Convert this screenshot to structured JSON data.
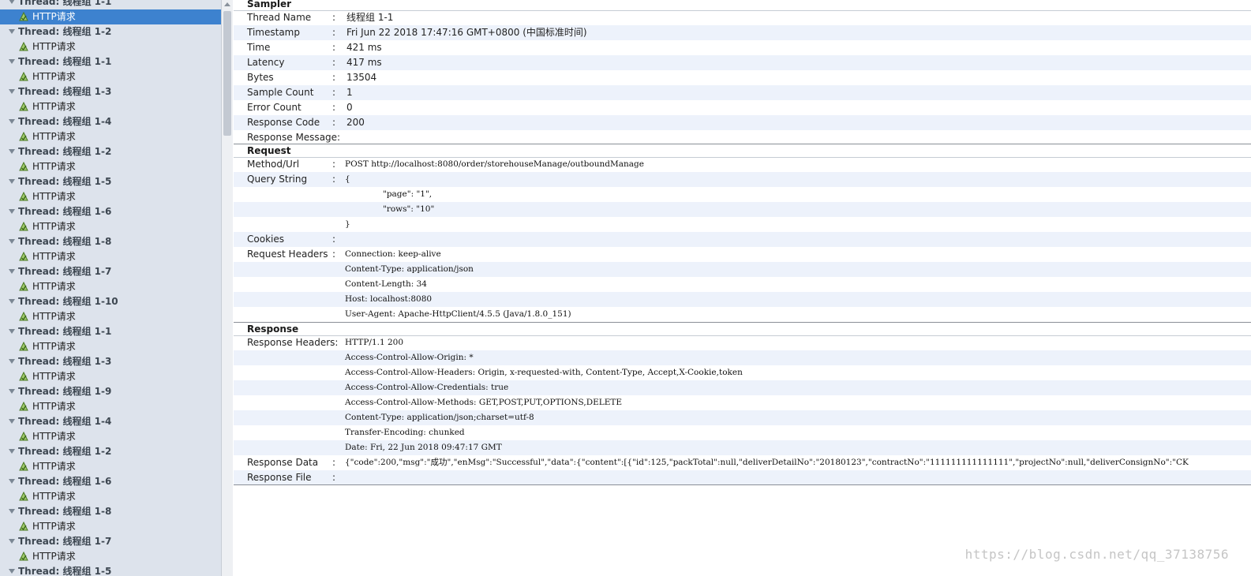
{
  "tree": [
    {
      "type": "thread",
      "label": "Thread: 线程组 1-1"
    },
    {
      "type": "sampler",
      "label": "HTTP请求",
      "selected": true
    },
    {
      "type": "thread",
      "label": "Thread: 线程组 1-2"
    },
    {
      "type": "sampler",
      "label": "HTTP请求"
    },
    {
      "type": "thread",
      "label": "Thread: 线程组 1-1"
    },
    {
      "type": "sampler",
      "label": "HTTP请求"
    },
    {
      "type": "thread",
      "label": "Thread: 线程组 1-3"
    },
    {
      "type": "sampler",
      "label": "HTTP请求"
    },
    {
      "type": "thread",
      "label": "Thread: 线程组 1-4"
    },
    {
      "type": "sampler",
      "label": "HTTP请求"
    },
    {
      "type": "thread",
      "label": "Thread: 线程组 1-2"
    },
    {
      "type": "sampler",
      "label": "HTTP请求"
    },
    {
      "type": "thread",
      "label": "Thread: 线程组 1-5"
    },
    {
      "type": "sampler",
      "label": "HTTP请求"
    },
    {
      "type": "thread",
      "label": "Thread: 线程组 1-6"
    },
    {
      "type": "sampler",
      "label": "HTTP请求"
    },
    {
      "type": "thread",
      "label": "Thread: 线程组 1-8"
    },
    {
      "type": "sampler",
      "label": "HTTP请求"
    },
    {
      "type": "thread",
      "label": "Thread: 线程组 1-7"
    },
    {
      "type": "sampler",
      "label": "HTTP请求"
    },
    {
      "type": "thread",
      "label": "Thread: 线程组 1-10"
    },
    {
      "type": "sampler",
      "label": "HTTP请求"
    },
    {
      "type": "thread",
      "label": "Thread: 线程组 1-1"
    },
    {
      "type": "sampler",
      "label": "HTTP请求"
    },
    {
      "type": "thread",
      "label": "Thread: 线程组 1-3"
    },
    {
      "type": "sampler",
      "label": "HTTP请求"
    },
    {
      "type": "thread",
      "label": "Thread: 线程组 1-9"
    },
    {
      "type": "sampler",
      "label": "HTTP请求"
    },
    {
      "type": "thread",
      "label": "Thread: 线程组 1-4"
    },
    {
      "type": "sampler",
      "label": "HTTP请求"
    },
    {
      "type": "thread",
      "label": "Thread: 线程组 1-2"
    },
    {
      "type": "sampler",
      "label": "HTTP请求"
    },
    {
      "type": "thread",
      "label": "Thread: 线程组 1-6"
    },
    {
      "type": "sampler",
      "label": "HTTP请求"
    },
    {
      "type": "thread",
      "label": "Thread: 线程组 1-8"
    },
    {
      "type": "sampler",
      "label": "HTTP请求"
    },
    {
      "type": "thread",
      "label": "Thread: 线程组 1-7"
    },
    {
      "type": "sampler",
      "label": "HTTP请求"
    },
    {
      "type": "thread",
      "label": "Thread: 线程组 1-5"
    }
  ],
  "sampler": {
    "heading": "Sampler",
    "rows": [
      {
        "label": "Thread Name",
        "value": "线程组 1-1"
      },
      {
        "label": "Timestamp",
        "value": "Fri Jun 22 2018 17:47:16 GMT+0800 (中国标准时间)"
      },
      {
        "label": "Time",
        "value": "421 ms"
      },
      {
        "label": "Latency",
        "value": "417 ms"
      },
      {
        "label": "Bytes",
        "value": "13504"
      },
      {
        "label": "Sample Count",
        "value": "1"
      },
      {
        "label": "Error Count",
        "value": "0"
      },
      {
        "label": "Response Code",
        "value": "200"
      },
      {
        "label": "Response Message:",
        "value": ""
      }
    ]
  },
  "request": {
    "heading": "Request",
    "method_url_label": "Method/Url",
    "method_url": "POST http://localhost:8080/order/storehouseManage/outboundManage",
    "query_label": "Query String",
    "query_lines": [
      "{",
      "\"page\": \"1\",",
      "\"rows\": \"10\"",
      "}"
    ],
    "cookies_label": "Cookies",
    "headers_label": "Request Headers",
    "headers": [
      "Connection: keep-alive",
      "Content-Type: application/json",
      "Content-Length: 34",
      "Host: localhost:8080",
      "User-Agent: Apache-HttpClient/4.5.5 (Java/1.8.0_151)"
    ]
  },
  "response": {
    "heading": "Response",
    "headers_label": "Response Headers:",
    "headers": [
      "HTTP/1.1 200",
      "Access-Control-Allow-Origin: *",
      "Access-Control-Allow-Headers: Origin, x-requested-with, Content-Type, Accept,X-Cookie,token",
      "Access-Control-Allow-Credentials: true",
      "Access-Control-Allow-Methods: GET,POST,PUT,OPTIONS,DELETE",
      "Content-Type: application/json;charset=utf-8",
      "Transfer-Encoding: chunked",
      "Date: Fri, 22 Jun 2018 09:47:17 GMT"
    ],
    "data_label": "Response Data",
    "data": "{\"code\":200,\"msg\":\"成功\",\"enMsg\":\"Successful\",\"data\":{\"content\":[{\"id\":125,\"packTotal\":null,\"deliverDetailNo\":\"20180123\",\"contractNo\":\"111111111111111\",\"projectNo\":null,\"deliverConsignNo\":\"CK",
    "file_label": "Response File"
  },
  "colon": ":",
  "watermark": "https://blog.csdn.net/qq_37138756"
}
